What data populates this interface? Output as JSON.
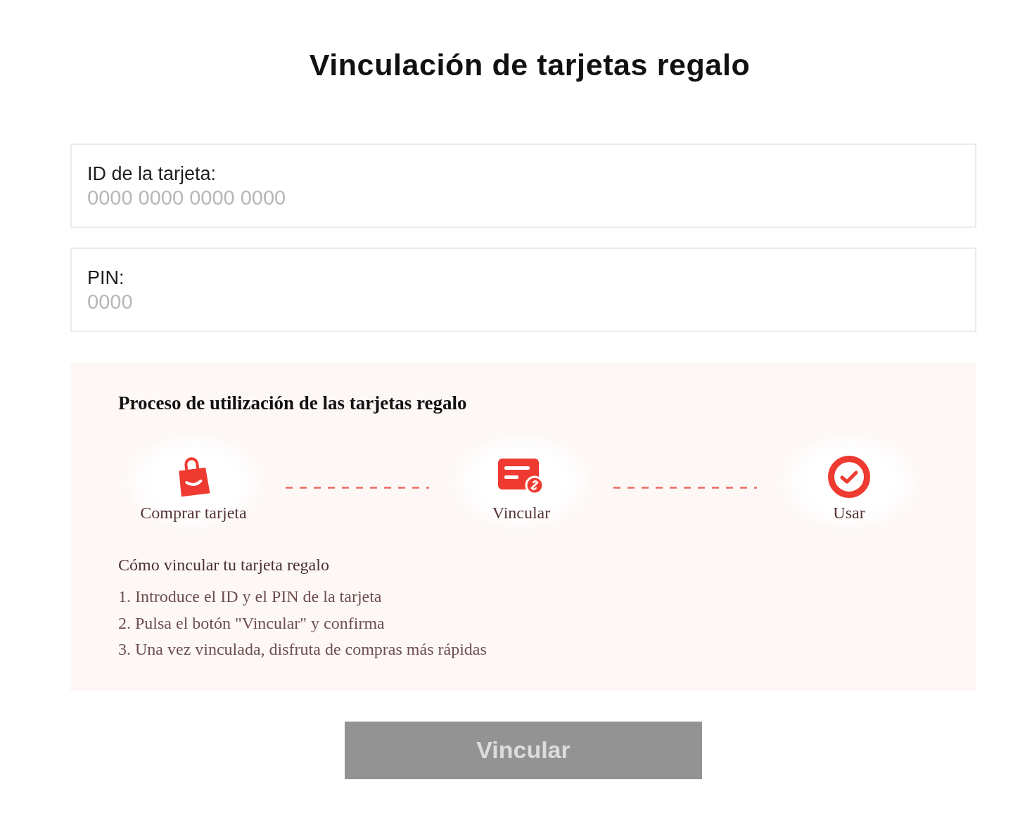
{
  "page": {
    "title": "Vinculación de tarjetas regalo"
  },
  "fields": [
    {
      "label": "ID de la tarjeta:",
      "placeholder": "0000 0000 0000 0000"
    },
    {
      "label": "PIN:",
      "placeholder": "0000"
    }
  ],
  "process": {
    "title": "Proceso de utilización de las tarjetas regalo",
    "steps": [
      {
        "label": "Comprar tarjeta"
      },
      {
        "label": "Vincular"
      },
      {
        "label": "Usar"
      }
    ],
    "howto_title": "Cómo vincular tu tarjeta regalo",
    "howto_steps": [
      "1. Introduce el ID y el PIN de la tarjeta",
      "2. Pulsa el botón \"Vincular\" y confirma",
      "3. Una vez vinculada, disfruta de compras más rápidas"
    ]
  },
  "submit_button": {
    "label": "Vincular",
    "disabled": true
  }
}
